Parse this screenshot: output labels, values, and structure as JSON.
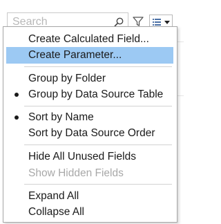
{
  "search": {
    "placeholder": "Search"
  },
  "menu": {
    "items": [
      {
        "label": "Create Calculated Field...",
        "checked": false,
        "disabled": false,
        "highlight": false
      },
      {
        "label": "Create Parameter...",
        "checked": false,
        "disabled": false,
        "highlight": true
      },
      {
        "label": "Group by Folder",
        "checked": false,
        "disabled": false,
        "highlight": false
      },
      {
        "label": "Group by Data Source Table",
        "checked": true,
        "disabled": false,
        "highlight": false
      },
      {
        "label": "Sort by Name",
        "checked": true,
        "disabled": false,
        "highlight": false
      },
      {
        "label": "Sort by Data Source Order",
        "checked": false,
        "disabled": false,
        "highlight": false
      },
      {
        "label": "Hide All Unused Fields",
        "checked": false,
        "disabled": false,
        "highlight": false
      },
      {
        "label": "Show Hidden Fields",
        "checked": false,
        "disabled": true,
        "highlight": false
      },
      {
        "label": "Expand All",
        "checked": false,
        "disabled": false,
        "highlight": false
      },
      {
        "label": "Collapse All",
        "checked": false,
        "disabled": false,
        "highlight": false
      }
    ]
  },
  "icons": {
    "search": "search-icon",
    "filter": "filter-icon",
    "view": "list-view-icon",
    "dropdown": "chevron-down-icon"
  },
  "colors": {
    "highlight": "#9cc9f3",
    "disabled_text": "#a8a8a8",
    "text": "#1a1a1a"
  }
}
